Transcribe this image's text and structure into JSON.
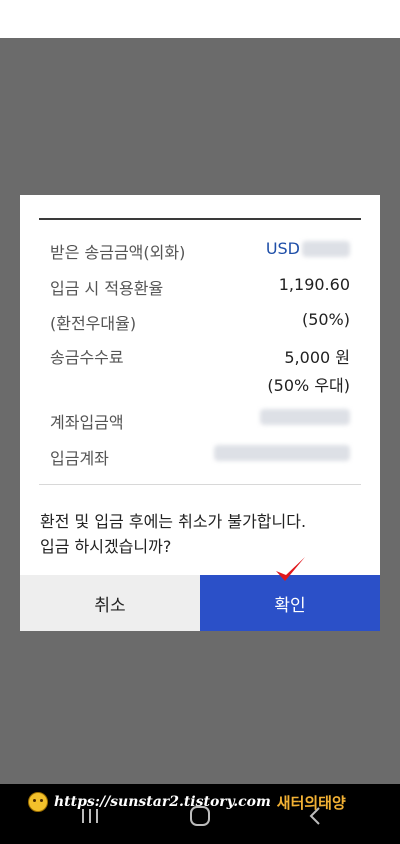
{
  "dialog": {
    "rows": [
      {
        "label": "받은 송금금액(외화)",
        "value": "USD"
      },
      {
        "label": "입금 시 적용환율",
        "value": "1,190.60"
      },
      {
        "label": "(환전우대율)",
        "value": "(50%)"
      },
      {
        "label": "송금수수료",
        "value": "5,000 원",
        "value2": "(50% 우대)"
      },
      {
        "label": "계좌입금액",
        "value": ""
      },
      {
        "label": "입금계좌",
        "value": ""
      }
    ],
    "notice_line1": "환전 및 입금 후에는 취소가 불가합니다.",
    "notice_line2": "입금 하시겠습니까?",
    "cancel_label": "취소",
    "confirm_label": "확인"
  },
  "watermark": {
    "url": "https://sunstar2.tistory.com",
    "name": "새터의태양"
  },
  "colors": {
    "confirm_button": "#2b50c8",
    "cancel_button": "#eeeeee",
    "usd_text": "#1f4fa8",
    "check_mark": "#e0171c"
  }
}
